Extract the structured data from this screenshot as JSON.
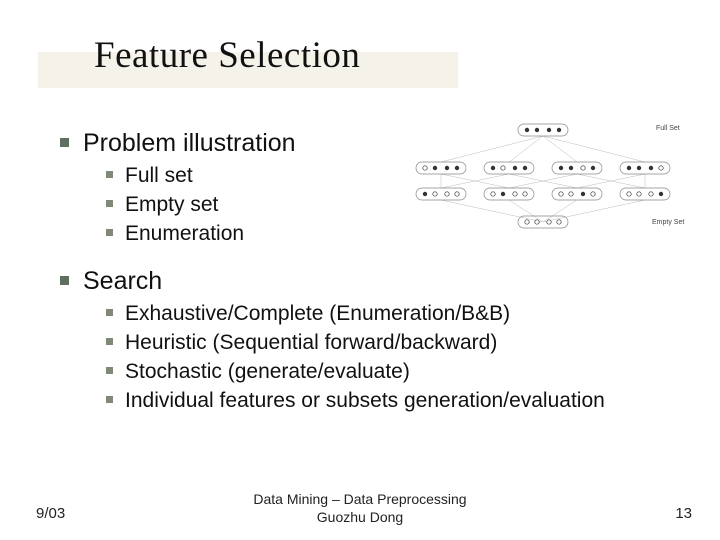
{
  "title": "Feature Selection",
  "sections": [
    {
      "heading": "Problem illustration",
      "items": [
        "Full set",
        "Empty set",
        "Enumeration"
      ]
    },
    {
      "heading": "Search",
      "items": [
        "Exhaustive/Complete (Enumeration/B&B)",
        "Heuristic (Sequential forward/backward)",
        "Stochastic (generate/evaluate)",
        "Individual features or subsets generation/evaluation"
      ]
    }
  ],
  "figure": {
    "top_label": "Full Set",
    "bottom_label": "Empty Set"
  },
  "footer": {
    "left": "9/03",
    "center_line1": "Data Mining – Data Preprocessing",
    "center_line2": "Guozhu Dong",
    "right": "13"
  }
}
